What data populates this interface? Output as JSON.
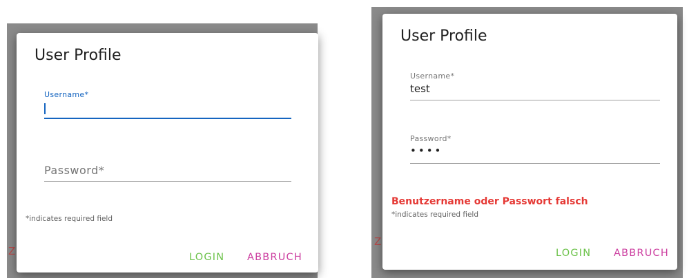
{
  "left_dialog": {
    "title": "User Profile",
    "username_label": "Username*",
    "username_value": "",
    "password_placeholder": "Password*",
    "required_note": "*indicates required field",
    "login_label": "LOGIN",
    "cancel_label": "ABBRUCH",
    "stray_char": "Z"
  },
  "right_dialog": {
    "title": "User Profile",
    "username_label": "Username*",
    "username_value": "test",
    "password_label": "Password*",
    "password_value": "••••",
    "error_message": "Benutzername oder Passwort falsch",
    "required_note": "*indicates required field",
    "login_label": "LOGIN",
    "cancel_label": "ABBRUCH",
    "stray_char": "Z"
  },
  "colors": {
    "focus_blue": "#1565c0",
    "error_red": "#e53935",
    "login_green": "#6cc24a",
    "cancel_magenta": "#cc3fa0",
    "backdrop_gray": "#8a8a8a"
  }
}
